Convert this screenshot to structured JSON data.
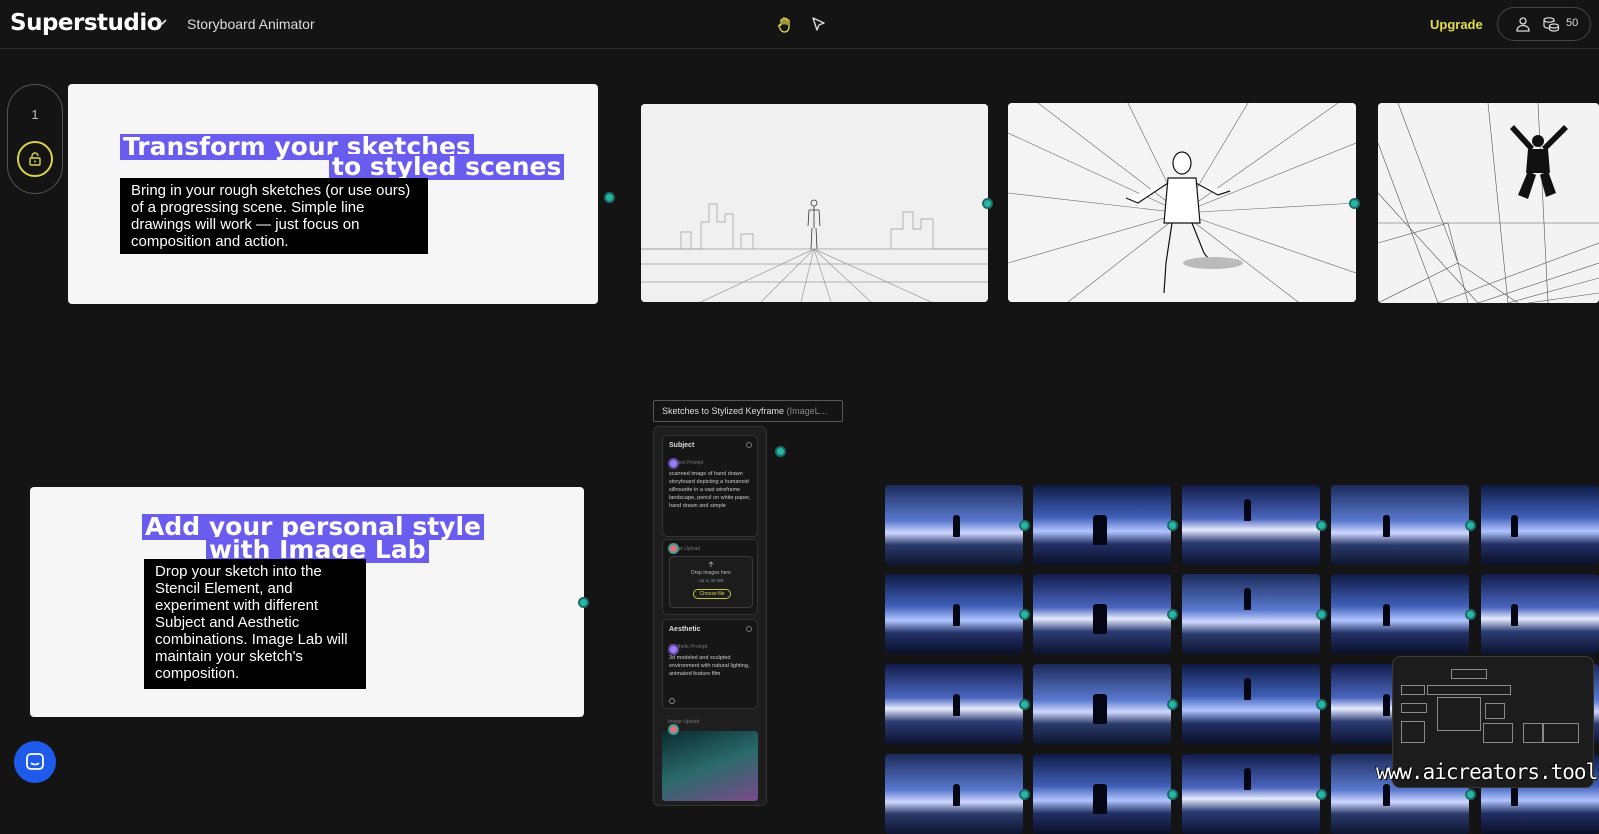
{
  "header": {
    "logo": "Superstudio",
    "project_name": "Storyboard Animator",
    "upgrade_label": "Upgrade",
    "credits": "50"
  },
  "sidebar": {
    "page_number": "1"
  },
  "card1": {
    "title_line1": "Transform your sketches",
    "title_line2": "to styled scenes",
    "body": "Bring in your rough sketches (or use ours) of a progressing scene. Simple line drawings will work — just focus on composition and action."
  },
  "card2": {
    "title_line1": "Add your personal style",
    "title_line2": "with Image Lab",
    "body": "Drop your sketch into the Stencil Element, and experiment with different Subject and Aesthetic combinations. Image Lab will maintain your sketch's composition."
  },
  "node": {
    "title": "Sketches to Stylized Keyframe",
    "title_suffix": "(ImageL...",
    "subject": {
      "label": "Subject",
      "prompt_label": "Subject Prompt",
      "prompt": "scanned image of hand drawn storyboard depicting a humanoid silhouette in a vast wireframe landscape, pencil on white paper, hand drawn and simple"
    },
    "upload1": {
      "label": "Image Upload",
      "drop_text": "Drop images here",
      "limit": "Up to 30 MB",
      "button": "Choose file"
    },
    "aesthetic": {
      "label": "Aesthetic",
      "prompt_label": "Aesthetic Prompt",
      "prompt": "3d modeled and sculpted environment with natural lighting, animated feature film"
    },
    "upload2": {
      "label": "Image Upload"
    }
  },
  "watermark": "www.aicreators.tools",
  "colors": {
    "accent_yellow": "#e4dc4a",
    "highlight_purple": "#6b5cf0",
    "port_teal": "#27b6a6",
    "background": "#141414"
  }
}
